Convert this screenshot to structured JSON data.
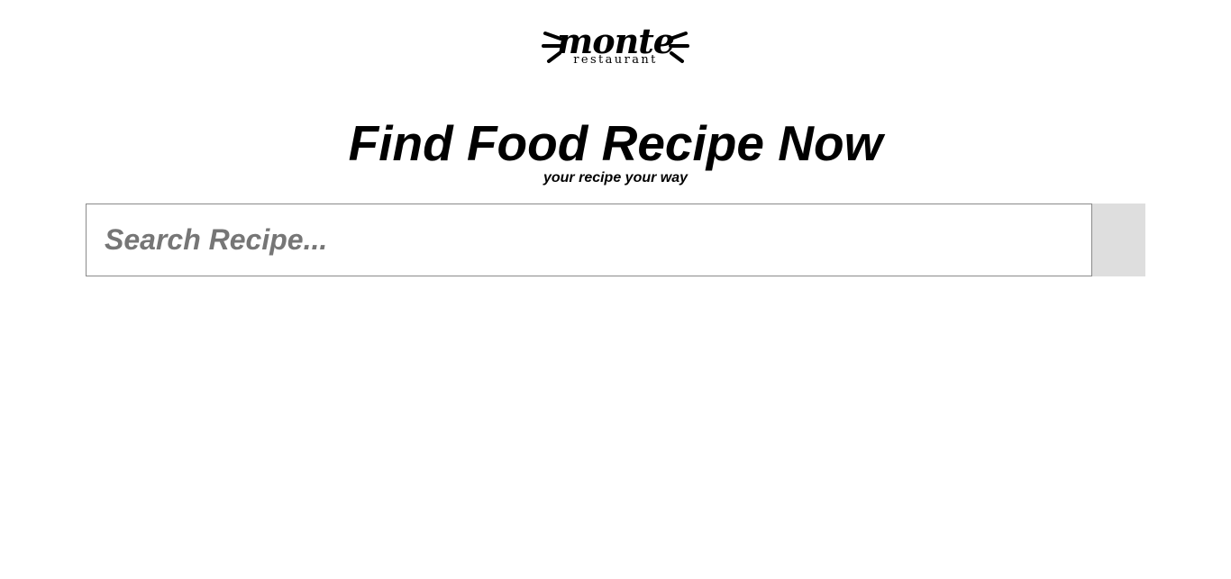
{
  "logo": {
    "word": "monte",
    "sub": "restaurant"
  },
  "hero": {
    "title": "Find Food Recipe Now",
    "subtitle": "your recipe your way"
  },
  "search": {
    "placeholder": "Search Recipe...",
    "value": "",
    "button_icon": "search-icon"
  },
  "colors": {
    "background": "#ffffff",
    "text": "#000000",
    "placeholder": "#767676",
    "input_border": "#8a8a8a",
    "button_bg": "#dedede"
  }
}
